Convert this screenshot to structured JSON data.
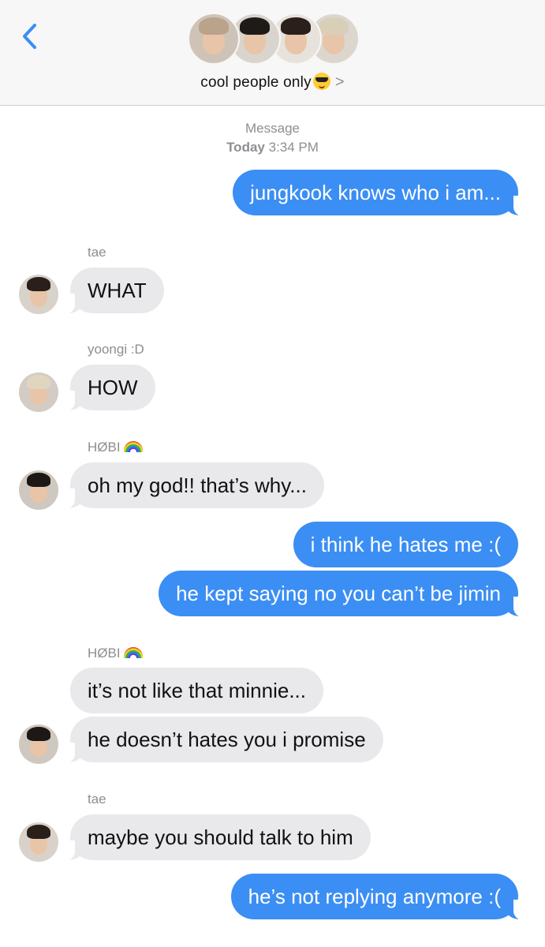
{
  "header": {
    "back_icon": "chevron-left-icon",
    "group_name": "cool people only",
    "group_emoji": "smiling-face-with-sunglasses",
    "chevron": ">",
    "accent_color": "#3b8ef3"
  },
  "timestamp": {
    "line1": "Message",
    "day": "Today",
    "time": "3:34 PM"
  },
  "messages": [
    {
      "dir": "out",
      "text": "jungkook knows who i am..."
    },
    {
      "dir": "in",
      "sender": "tae",
      "text": "WHAT"
    },
    {
      "dir": "in",
      "sender": "yoongi :D",
      "text": "HOW"
    },
    {
      "dir": "in",
      "sender": "HØBI",
      "sender_emoji": "rainbow",
      "text": "oh my god!! that’s why..."
    },
    {
      "dir": "out",
      "text": "i think he hates me :("
    },
    {
      "dir": "out",
      "text": "he kept saying no you can’t be jimin"
    },
    {
      "dir": "in",
      "sender": "HØBI",
      "sender_emoji": "rainbow",
      "text": "it’s not like that minnie..."
    },
    {
      "dir": "in",
      "text": "he doesn’t hates you i promise"
    },
    {
      "dir": "in",
      "sender": "tae",
      "text": "maybe you should talk to him"
    },
    {
      "dir": "out",
      "text": "he’s not replying anymore :("
    }
  ]
}
